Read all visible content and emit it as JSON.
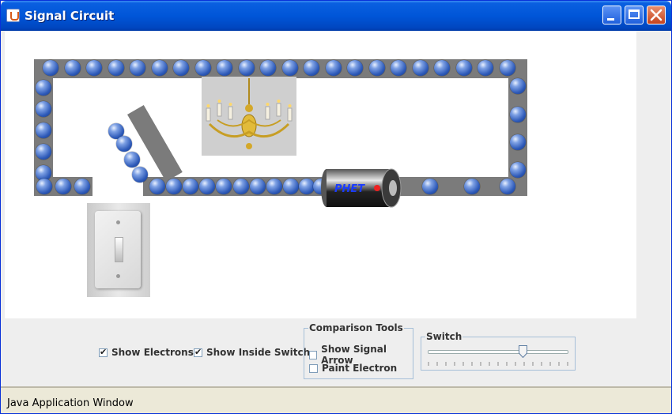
{
  "window": {
    "title": "Signal Circuit",
    "buttons": [
      "minimize",
      "maximize",
      "close"
    ]
  },
  "canvas": {
    "battery_label": "PHET",
    "images": [
      "chandelier",
      "battery",
      "light-switch"
    ]
  },
  "controls": {
    "show_electrons": {
      "label": "Show Electrons",
      "checked": true
    },
    "show_inside_switch": {
      "label": "Show Inside Switch",
      "checked": true
    },
    "comparison_tools": {
      "title": "Comparison Tools",
      "show_signal_arrow": {
        "label": "Show Signal Arrow",
        "checked": false
      },
      "paint_electron": {
        "label": "Paint Electron",
        "checked": false
      }
    },
    "switch": {
      "title": "Switch",
      "slider_value": 0.68
    }
  },
  "status": {
    "text": "Java Application Window"
  },
  "colors": {
    "wire": "#7b7b7b",
    "electron": "#2d59b8",
    "titlebar": "#0056d8"
  }
}
